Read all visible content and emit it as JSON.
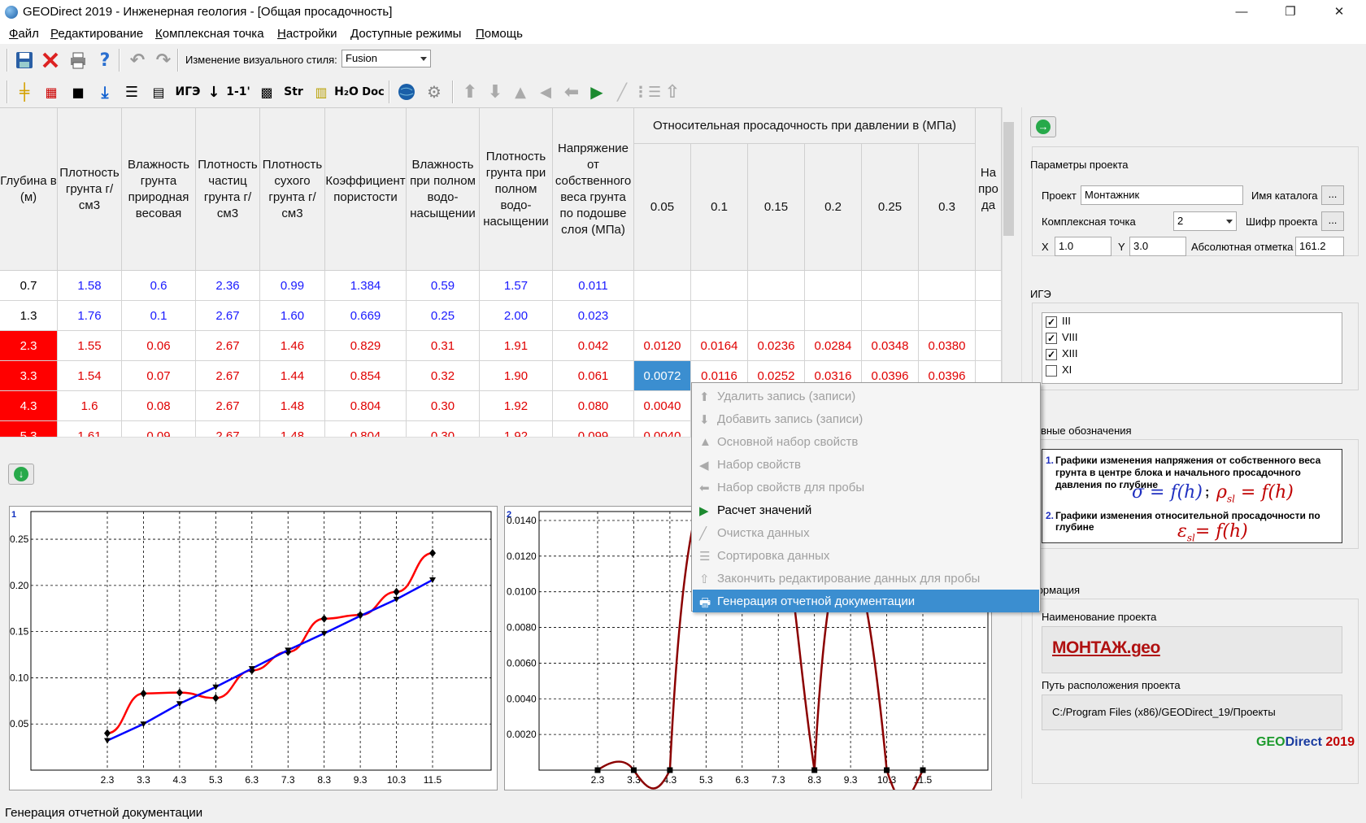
{
  "window": {
    "title": "GEODirect 2019 - Инженерная геология - [Общая просадочность]",
    "min": "—",
    "max": "❐",
    "close": "✕"
  },
  "menu": [
    "Файл",
    "Редактирование",
    "Комплексная точка",
    "Настройки",
    "Доступные режимы",
    "Помощь"
  ],
  "toolbar": {
    "style_label": "Изменение визуального стиля:",
    "style_value": "Fusion",
    "text_buttons": [
      "ИГЭ",
      "1-1'",
      "Str",
      "H₂O",
      "Doc"
    ]
  },
  "table": {
    "headers": [
      "Глубина в (м)",
      "Плотность грунта г/см3",
      "Влажность грунта природная весовая",
      "Плотность частиц грунта г/см3",
      "Плотность сухого грунта г/см3",
      "Коэффициент пористости",
      "Влажность при полном водо-насыщении",
      "Плотность грунта при полном водо-насыщении",
      "Напряжение от собственного веса грунта по подошве слоя (МПа)"
    ],
    "group_header": "Относительная просадочность при давлении в (МПа)",
    "pressures": [
      "0.05",
      "0.1",
      "0.15",
      "0.2",
      "0.25",
      "0.3"
    ],
    "extra_header": "На про да",
    "rows": [
      [
        "0.7",
        "1.58",
        "0.6",
        "2.36",
        "0.99",
        "1.384",
        "0.59",
        "1.57",
        "0.011",
        "",
        "",
        "",
        "",
        "",
        ""
      ],
      [
        "1.3",
        "1.76",
        "0.1",
        "2.67",
        "1.60",
        "0.669",
        "0.25",
        "2.00",
        "0.023",
        "",
        "",
        "",
        "",
        "",
        ""
      ],
      [
        "2.3",
        "1.55",
        "0.06",
        "2.67",
        "1.46",
        "0.829",
        "0.31",
        "1.91",
        "0.042",
        "0.0120",
        "0.0164",
        "0.0236",
        "0.0284",
        "0.0348",
        "0.0380"
      ],
      [
        "3.3",
        "1.54",
        "0.07",
        "2.67",
        "1.44",
        "0.854",
        "0.32",
        "1.90",
        "0.061",
        "0.0072",
        "0.0116",
        "0.0252",
        "0.0316",
        "0.0396",
        "0.0396"
      ],
      [
        "4.3",
        "1.6",
        "0.08",
        "2.67",
        "1.48",
        "0.804",
        "0.30",
        "1.92",
        "0.080",
        "0.0040",
        "",
        "",
        "",
        "",
        ""
      ],
      [
        "5.3",
        "1.61",
        "0.09",
        "2.67",
        "1.48",
        "0.804",
        "0.30",
        "1.92",
        "0.099",
        "0.0040",
        "",
        "",
        "",
        "",
        ""
      ]
    ]
  },
  "right_panel": {
    "project_params_title": "Параметры проекта",
    "project_label": "Проект",
    "project_value": "Монтажник",
    "catalog_label": "Имя каталога",
    "catalog_btn": "...",
    "point_label": "Комплексная точка",
    "point_value": "2",
    "cipher_label": "Шифр проекта",
    "cipher_btn": "...",
    "x_label": "X",
    "x_value": "1.0",
    "y_label": "Y",
    "y_value": "3.0",
    "abs_label": "Абсолютная отметка",
    "abs_value": "161.2",
    "ige_title": "ИГЭ",
    "ige_items": [
      {
        "label": "III",
        "checked": "✓"
      },
      {
        "label": "VIII",
        "checked": "✓"
      },
      {
        "label": "XIII",
        "checked": "✓"
      },
      {
        "label": "XI",
        "checked": ""
      }
    ],
    "legend_title": "ловные обозначения",
    "legend_1_num": "1.",
    "legend_1": "Графики изменения напряжения от собственного веса грунта в центре блока и начального просадочного давления по глубине",
    "legend_1_formula_a": "σ = f(h)",
    "legend_1_sep": ";",
    "legend_1_formula_b": "ρ",
    "legend_1_formula_b_sub": "sl",
    "legend_1_formula_b_rest": " = f(h)",
    "legend_2_num": "2.",
    "legend_2": "Графики изменения относительной просадочности по глубине",
    "legend_2_formula": "ε",
    "legend_2_formula_sub": "sl",
    "legend_2_formula_rest": "= f(h)",
    "info_title": "формация",
    "name_label": "Наименование проекта",
    "name_logo": "МОНТАЖ.geo",
    "path_label": "Путь расположения проекта",
    "path_value": "C:/Program Files (x86)/GEODirect_19/Проекты",
    "brand_geo": "GEO",
    "brand_direct": "Direct",
    "brand_year": " 2019"
  },
  "chart_data": [
    {
      "type": "line",
      "label": "1",
      "categories": [
        "2.3",
        "3.3",
        "4.3",
        "5.3",
        "6.3",
        "7.3",
        "8.3",
        "9.3",
        "10.3",
        "11.5"
      ],
      "yticks": [
        "0.05",
        "0.10",
        "0.15",
        "0.20",
        "0.25"
      ],
      "ylim": [
        0,
        0.28
      ],
      "series": [
        {
          "values": [
            0.04,
            0.083,
            0.084,
            0.078,
            0.108,
            0.128,
            0.164,
            0.168,
            0.193,
            0.235
          ],
          "color": "#ff0000"
        },
        {
          "values": [
            0.032,
            0.05,
            0.072,
            0.09,
            0.11,
            0.13,
            0.148,
            0.167,
            0.185,
            0.206
          ],
          "color": "#0000ff"
        }
      ]
    },
    {
      "type": "line",
      "label": "2",
      "categories": [
        "2.3",
        "3.3",
        "4.3",
        "5.3",
        "6.3",
        "7.3",
        "8.3",
        "9.3",
        "10.3",
        "11.5"
      ],
      "yticks": [
        "0.0020",
        "0.0040",
        "0.0060",
        "0.0080",
        "0.0100",
        "0.0120",
        "0.0140"
      ],
      "ylim": [
        0,
        0.0145
      ],
      "series": [
        {
          "values": [
            0.0,
            0.0,
            0.0,
            null,
            null,
            null,
            0.0,
            null,
            0.0,
            0.0
          ],
          "color": "#8b0000"
        }
      ]
    }
  ],
  "context_menu": [
    {
      "label": "Удалить запись (записи)",
      "enabled": false,
      "icon": "arrow-up-icon"
    },
    {
      "label": "Добавить запись (записи)",
      "enabled": false,
      "icon": "arrow-down-icon"
    },
    {
      "label": "Основной набор свойств",
      "enabled": false,
      "icon": "mountain-icon"
    },
    {
      "label": "Набор свойств",
      "enabled": false,
      "icon": "arrow-left-bar-icon"
    },
    {
      "label": "Набор свойств для пробы",
      "enabled": false,
      "icon": "arrow-left-icon"
    },
    {
      "label": "Расчет значений",
      "enabled": true,
      "icon": "play-icon"
    },
    {
      "label": "Очистка данных",
      "enabled": false,
      "icon": "pen-icon"
    },
    {
      "label": "Сортировка данных",
      "enabled": false,
      "icon": "sort-icon"
    },
    {
      "label": "Закончить редактирование данных для пробы",
      "enabled": false,
      "icon": "arrow-up-end-icon"
    },
    {
      "label": "Генерация отчетной документации",
      "enabled": true,
      "highlighted": true,
      "icon": "printer-icon"
    }
  ],
  "status": "Генерация отчетной документации"
}
